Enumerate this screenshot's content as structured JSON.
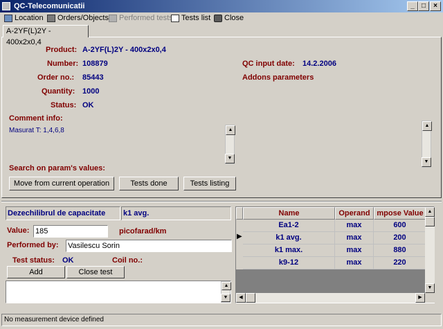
{
  "window": {
    "title": "QC-Telecomunicatii",
    "min": "_",
    "max": "□",
    "close": "×"
  },
  "menu": [
    {
      "label": "Location",
      "icon": "location-icon"
    },
    {
      "label": "Orders/Objects",
      "icon": "orders-icon"
    },
    {
      "label": "Performed tests",
      "icon": "tests-icon"
    },
    {
      "label": "Tests list",
      "icon": "list-icon"
    },
    {
      "label": "Close",
      "icon": "close-icon"
    }
  ],
  "tab": {
    "label": "A-2YF(L)2Y - 400x2x0,4"
  },
  "details": {
    "product_label": "Product:",
    "product_value": "A-2YF(L)2Y - 400x2x0,4",
    "number_label": "Number:",
    "number_value": "108879",
    "order_label": "Order no.:",
    "order_value": "85443",
    "quantity_label": "Quantity:",
    "quantity_value": "1000",
    "status_label": "Status:",
    "status_value": "OK",
    "qc_date_label": "QC input date:",
    "qc_date_value": "14.2.2006",
    "addons_label": "Addons parameters"
  },
  "comment": {
    "label": "Comment info:",
    "text": "Masurat T: 1,4,6,8"
  },
  "search": {
    "label": "Search on param's values:",
    "btn_move": "Move from current operation",
    "btn_done": "Tests done",
    "btn_listing": "Tests listing"
  },
  "test": {
    "param_name": "Dezechilibrul de capacitate",
    "param_short": "k1 avg.",
    "value_label": "Value:",
    "value": "185",
    "unit": "picofarad/km",
    "performed_label": "Performed by:",
    "performed_value": "Vasilescu Sorin",
    "status_label": "Test status:",
    "status_value": "OK",
    "coil_label": "Coil no.:",
    "btn_add": "Add",
    "btn_close": "Close test"
  },
  "grid": {
    "headers": [
      "Name",
      "Operand",
      "mpose Value"
    ],
    "rows": [
      [
        "Ea1-2",
        "max",
        "600"
      ],
      [
        "k1 avg.",
        "max",
        "200"
      ],
      [
        "k1 max.",
        "max",
        "880"
      ],
      [
        "k9-12",
        "max",
        "220"
      ]
    ],
    "row_indicator": "▶"
  },
  "statusbar": {
    "text": "No measurement device defined"
  }
}
